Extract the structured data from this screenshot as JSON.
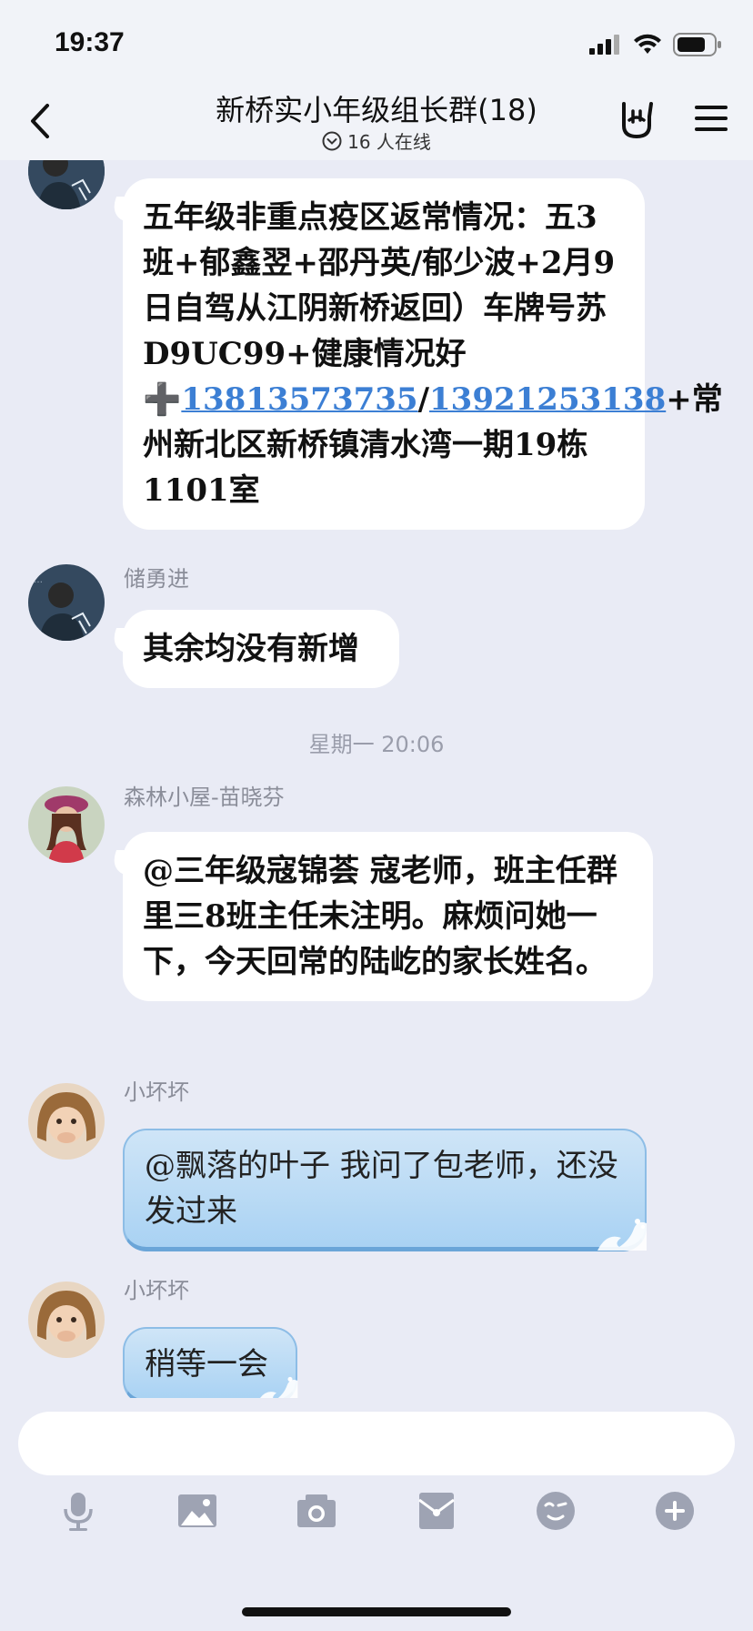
{
  "status_bar": {
    "time": "19:37"
  },
  "header": {
    "title": "新桥实小年级组长群(18)",
    "online": "16 人在线"
  },
  "messages": [
    {
      "text_parts": [
        "五年级非重点疫区返常情况：五3班+郁鑫翌+邵丹英/郁少波+2月9日自驾从江阴新桥返回）车牌号苏D9UC99+健康情况好➕",
        "13813573735",
        "/",
        "13921253138",
        "+常州新北区新桥镇清水湾一期19栋1101室"
      ]
    },
    {
      "sender": "储勇进",
      "text": "其余均没有新增"
    },
    {
      "time_separator": "星期一 20:06"
    },
    {
      "sender": "森林小屋-苗晓芬",
      "text": "@三年级寇锦荟 寇老师，班主任群里三8班主任未注明。麻烦问她一下，今天回常的陆屹的家长姓名。"
    },
    {
      "sender": "小坏坏",
      "text": "@飘落的叶子 我问了包老师，还没发过来"
    },
    {
      "sender": "小坏坏",
      "text": "稍等一会"
    }
  ],
  "toolbar": {
    "icons": [
      "microphone-icon",
      "image-icon",
      "camera-icon",
      "red-packet-icon",
      "emoji-icon",
      "plus-icon"
    ]
  },
  "colors": {
    "background": "#e9ebf5",
    "bubble": "#ffffff",
    "blue_bubble": "#a9d2f3",
    "link": "#3c7fd4",
    "meta_text": "#8a8d99"
  }
}
